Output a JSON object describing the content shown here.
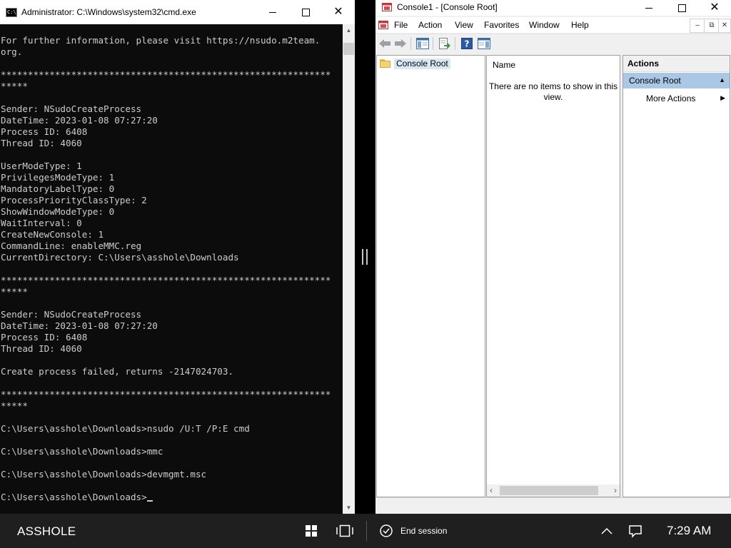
{
  "cmd": {
    "title": "Administrator: C:\\Windows\\system32\\cmd.exe",
    "icon_label": "C:\\",
    "icons": {
      "minimize": "minimize-icon",
      "maximize": "maximize-icon",
      "close": "close-icon"
    },
    "console_text": "For further information, please visit https://nsudo.m2team.\norg.\n\n*************************************************************\n*****\n\nSender: NSudoCreateProcess\nDateTime: 2023-01-08 07:27:20\nProcess ID: 6408\nThread ID: 4060\n\nUserModeType: 1\nPrivilegesModeType: 1\nMandatoryLabelType: 0\nProcessPriorityClassType: 2\nShowWindowModeType: 0\nWaitInterval: 0\nCreateNewConsole: 1\nCommandLine: enableMMC.reg\nCurrentDirectory: C:\\Users\\asshole\\Downloads\n\n*************************************************************\n*****\n\nSender: NSudoCreateProcess\nDateTime: 2023-01-08 07:27:20\nProcess ID: 6408\nThread ID: 4060\n\nCreate process failed, returns -2147024703.\n\n*************************************************************\n*****\n\nC:\\Users\\asshole\\Downloads>nsudo /U:T /P:E cmd\n\nC:\\Users\\asshole\\Downloads>mmc\n\nC:\\Users\\asshole\\Downloads>devmgmt.msc\n\nC:\\Users\\asshole\\Downloads>"
  },
  "mmc": {
    "title": "Console1 - [Console Root]",
    "menu": [
      "File",
      "Action",
      "View",
      "Favorites",
      "Window",
      "Help"
    ],
    "toolbar_icons": [
      "back-arrow-icon",
      "forward-arrow-icon",
      "show-hide-tree-icon",
      "export-list-icon",
      "help-icon",
      "action-pane-icon"
    ],
    "tree": {
      "root_label": "Console Root"
    },
    "center": {
      "column_name": "Name",
      "empty_message": "There are no items to show in this view."
    },
    "actions": {
      "header": "Actions",
      "group_label": "Console Root",
      "more_actions": "More Actions"
    }
  },
  "taskbar": {
    "user": "ASSHOLE",
    "end_session": "End session",
    "clock": "7:29 AM",
    "icons": [
      "windows-start-icon",
      "task-view-icon",
      "end-session-icon",
      "chevron-up-icon",
      "notification-icon"
    ]
  },
  "colors": {
    "console_bg": "#0c0c0c",
    "console_fg": "#cccccc",
    "taskbar_bg": "#1f1f1f",
    "selection": "#aac8e6"
  }
}
